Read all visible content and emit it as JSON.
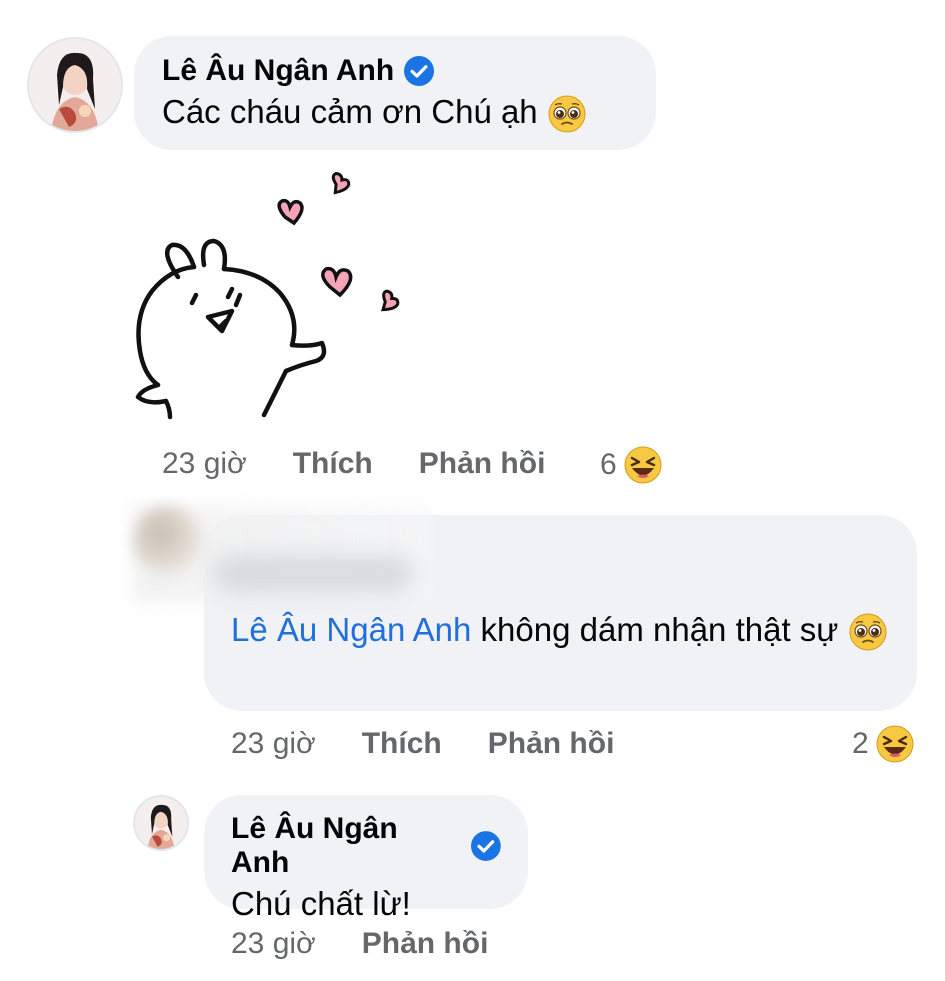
{
  "comments": [
    {
      "author": "Lê Âu Ngân Anh",
      "verified": true,
      "text": "Các cháu cảm ơn Chú ạh",
      "emoji": "pleading-face",
      "sticker": "bunny-with-hearts-sticker",
      "time": "23 giờ",
      "like_label": "Thích",
      "reply_label": "Phản hồi",
      "reaction_count": "6",
      "reaction_type": "laughing-emoji"
    },
    {
      "author": "",
      "mention": "Lê Âu Ngân Anh",
      "text": "không dám nhận thật sự",
      "emoji": "pleading-face",
      "time": "23 giờ",
      "like_label": "Thích",
      "reply_label": "Phản hồi",
      "reaction_count": "2",
      "reaction_type": "laughing-emoji"
    },
    {
      "author": "Lê Âu Ngân Anh",
      "verified": true,
      "text": "Chú chất lừ!",
      "time": "23 giờ",
      "reply_label": "Phản hồi"
    }
  ],
  "colors": {
    "bubble": "#f0f2f5",
    "meta_text": "#65676b",
    "mention": "#216fdb",
    "verified": "#1b74e4"
  }
}
